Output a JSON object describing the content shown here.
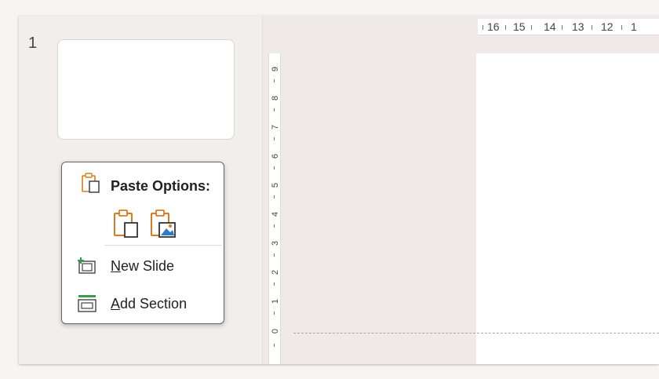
{
  "slide_panel": {
    "slide_number": "1"
  },
  "rulers": {
    "horizontal_labels": [
      "16",
      "15",
      "14",
      "13",
      "12",
      "1"
    ],
    "vertical_labels": [
      "9",
      "8",
      "7",
      "6",
      "5",
      "4",
      "3",
      "2",
      "1",
      "0"
    ]
  },
  "context_menu": {
    "paste_header": "Paste Options:",
    "paste_options": [
      {
        "icon": "keep-source-formatting-icon"
      },
      {
        "icon": "picture-paste-icon"
      }
    ],
    "new_slide": {
      "mnemonic": "N",
      "rest": "ew Slide",
      "icon": "new-slide-icon"
    },
    "add_section": {
      "mnemonic": "A",
      "rest": "dd Section",
      "icon": "add-section-icon"
    }
  },
  "colors": {
    "accent_orange": "#d97b1f",
    "icon_green": "#3a9b4c",
    "icon_blue": "#3279c8"
  }
}
